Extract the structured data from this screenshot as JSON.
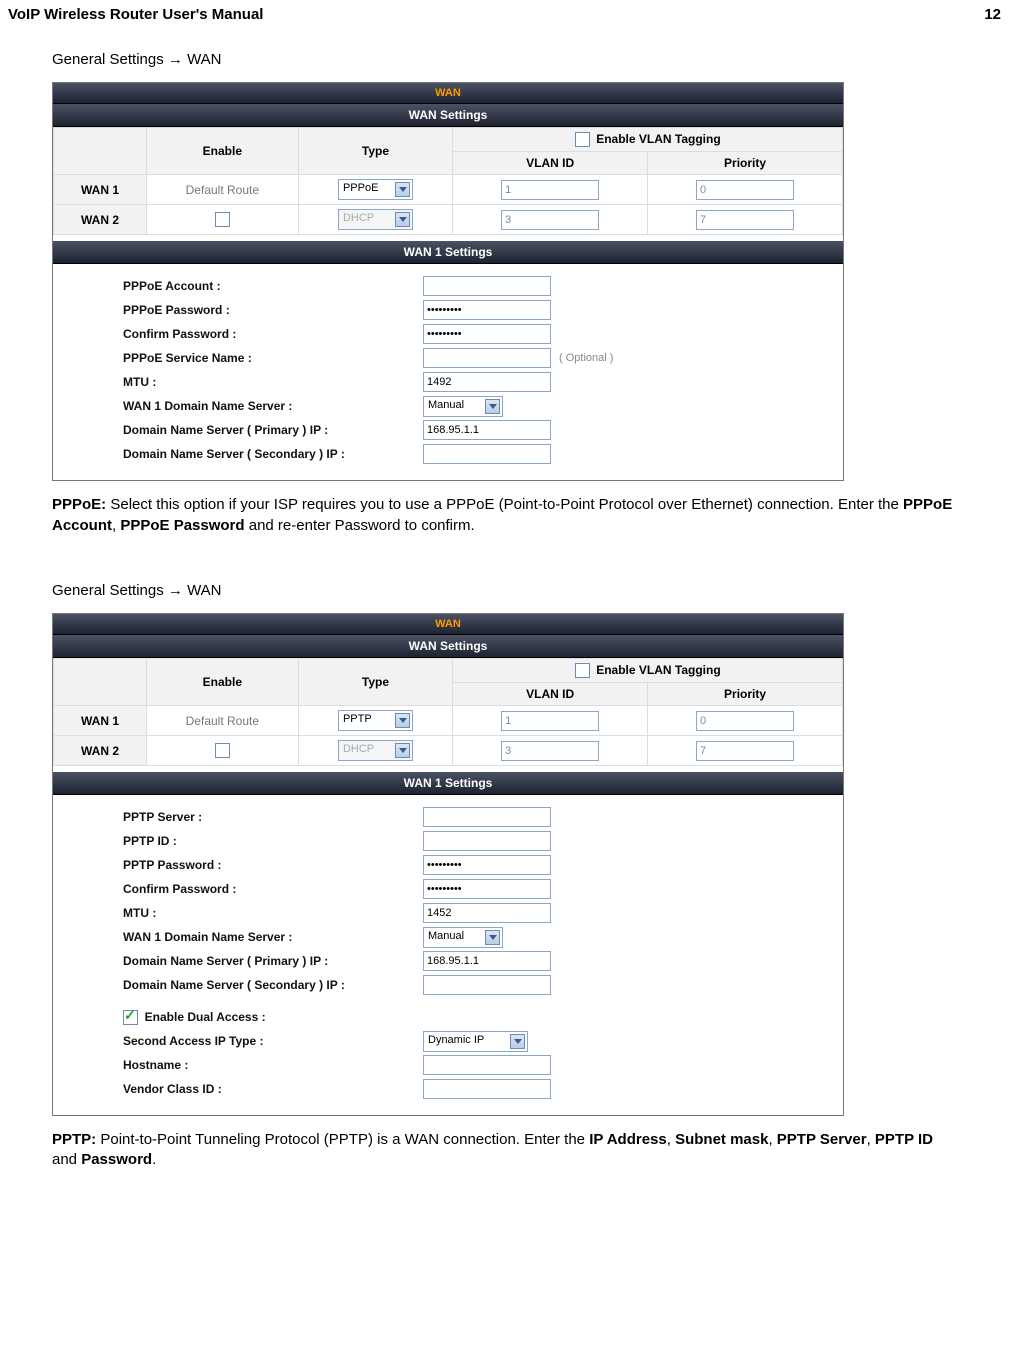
{
  "header": {
    "title": "VoIP Wireless Router User's Manual",
    "page": "12"
  },
  "sec1": {
    "breadcrumb": "General Settings  →  WAN",
    "topbar": "WAN",
    "settingsbar": "WAN Settings",
    "cols": {
      "enable": "Enable",
      "type": "Type",
      "vlaneb": "Enable VLAN Tagging",
      "vlanid": "VLAN ID",
      "prio": "Priority"
    },
    "r1": {
      "name": "WAN 1",
      "enable": "Default Route",
      "type": "PPPoE",
      "vlan": "1",
      "prio": "0"
    },
    "r2": {
      "name": "WAN 2",
      "type": "DHCP",
      "vlan": "3",
      "prio": "7"
    },
    "w1bar": "WAN 1 Settings",
    "f": {
      "acct_l": "PPPoE Account :",
      "acct_v": "",
      "pw_l": "PPPoE Password :",
      "pw_v": "•••••••••",
      "cpw_l": "Confirm Password :",
      "cpw_v": "•••••••••",
      "svc_l": "PPPoE Service Name :",
      "svc_v": "",
      "svc_o": "( Optional )",
      "mtu_l": "MTU :",
      "mtu_v": "1492",
      "dns_l": "WAN 1 Domain Name Server :",
      "dns_v": "Manual",
      "dnsp_l": "Domain Name Server ( Primary ) IP :",
      "dnsp_v": "168.95.1.1",
      "dnss_l": "Domain Name Server ( Secondary ) IP :",
      "dnss_v": ""
    },
    "desc_pre": "PPPoE: ",
    "desc_a": "Select this option if your ISP requires you to use a PPPoE (Point-to-Point Protocol over Ethernet) connection. Enter the ",
    "desc_b1": "PPPoE Account",
    "desc_c": ", ",
    "desc_b2": "PPPoE Password",
    "desc_d": " and re-enter Password to confirm."
  },
  "sec2": {
    "breadcrumb": "General Settings  →  WAN",
    "topbar": "WAN",
    "settingsbar": "WAN Settings",
    "r1": {
      "name": "WAN 1",
      "enable": "Default Route",
      "type": "PPTP",
      "vlan": "1",
      "prio": "0"
    },
    "r2": {
      "name": "WAN 2",
      "type": "DHCP",
      "vlan": "3",
      "prio": "7"
    },
    "w1bar": "WAN 1 Settings",
    "f": {
      "srv_l": "PPTP Server :",
      "srv_v": "",
      "id_l": "PPTP ID :",
      "id_v": "",
      "pw_l": "PPTP Password :",
      "pw_v": "•••••••••",
      "cpw_l": "Confirm Password :",
      "cpw_v": "•••••••••",
      "mtu_l": "MTU :",
      "mtu_v": "1452",
      "dns_l": "WAN 1 Domain Name Server :",
      "dns_v": "Manual",
      "dnsp_l": "Domain Name Server ( Primary ) IP :",
      "dnsp_v": "168.95.1.1",
      "dnss_l": "Domain Name Server ( Secondary ) IP :",
      "dnss_v": "",
      "dual_l": "Enable Dual Access :",
      "sat_l": "Second Access IP Type :",
      "sat_v": "Dynamic IP",
      "host_l": "Hostname  :",
      "host_v": "",
      "vc_l": "Vendor Class ID :",
      "vc_v": ""
    },
    "desc_pre": "PPTP: ",
    "desc_a": "Point-to-Point Tunneling Protocol (PPTP) is a WAN connection. Enter the ",
    "desc_b1": "IP Address",
    "desc_c1": ", ",
    "desc_b2": "Subnet mask",
    "desc_c2": ", ",
    "desc_b3": "PPTP Server",
    "desc_c3": ", ",
    "desc_b4": "PPTP ID",
    "desc_c4": " and ",
    "desc_b5": "Password",
    "desc_d": "."
  }
}
